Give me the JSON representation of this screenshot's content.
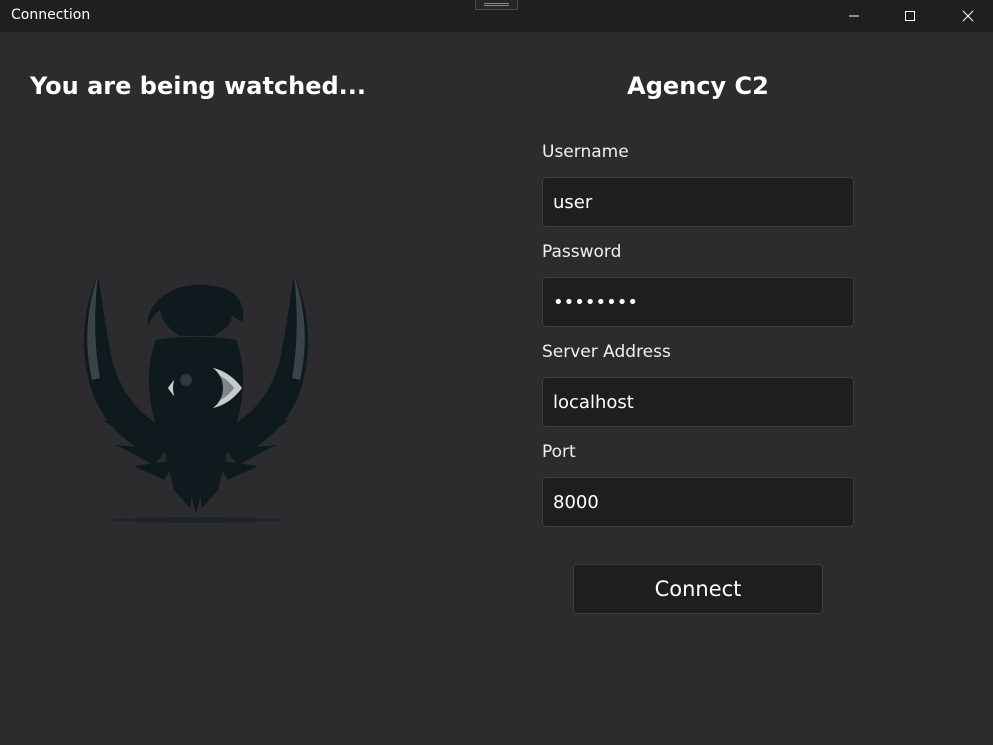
{
  "window": {
    "title": "Connection",
    "minimize_icon": "minimize-icon",
    "maximize_icon": "maximize-icon",
    "close_icon": "close-icon"
  },
  "left_panel": {
    "heading": "You are being watched...",
    "logo_icon": "eagle-eye-logo"
  },
  "form": {
    "heading": "Agency C2",
    "username_label": "Username",
    "username_value": "user",
    "password_label": "Password",
    "password_value": "••••••••",
    "server_label": "Server Address",
    "server_value": "localhost",
    "port_label": "Port",
    "port_value": "8000",
    "connect_label": "Connect"
  }
}
